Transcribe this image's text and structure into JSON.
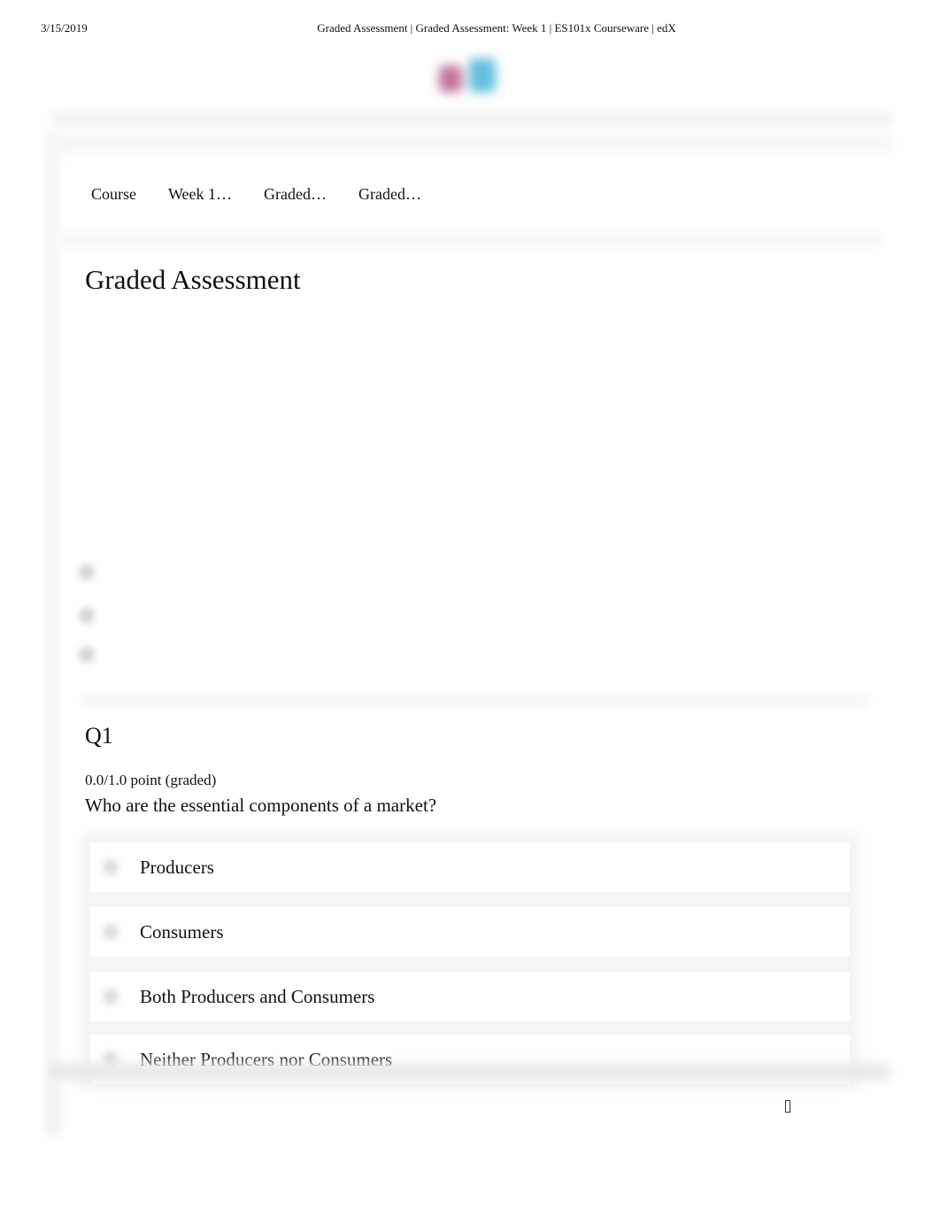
{
  "print_header": {
    "date": "3/15/2019",
    "title": "Graded Assessment | Graded Assessment: Week 1 | ES101x Courseware | edX"
  },
  "logo": {
    "name": "edx-logo",
    "colors": [
      "#c0729a",
      "#62bede"
    ]
  },
  "breadcrumb": [
    {
      "label": "Course"
    },
    {
      "label": "Week 1…"
    },
    {
      "label": "Graded…"
    },
    {
      "label": "Graded…"
    }
  ],
  "page_title": "Graded Assessment",
  "sequence_nav": [
    {
      "icon": "nav-dot-icon"
    },
    {
      "icon": "nav-dot-icon"
    },
    {
      "icon": "nav-dot-icon"
    }
  ],
  "question": {
    "title": "Q1",
    "points": "0.0/1.0 point (graded)",
    "text": "Who are the essential components of a market?",
    "options": [
      {
        "label": "Producers"
      },
      {
        "label": "Consumers"
      },
      {
        "label": "Both Producers and Consumers"
      },
      {
        "label": "Neither Producers nor Consumers"
      }
    ]
  },
  "footer": {
    "icon": "missing-glyph-icon"
  }
}
